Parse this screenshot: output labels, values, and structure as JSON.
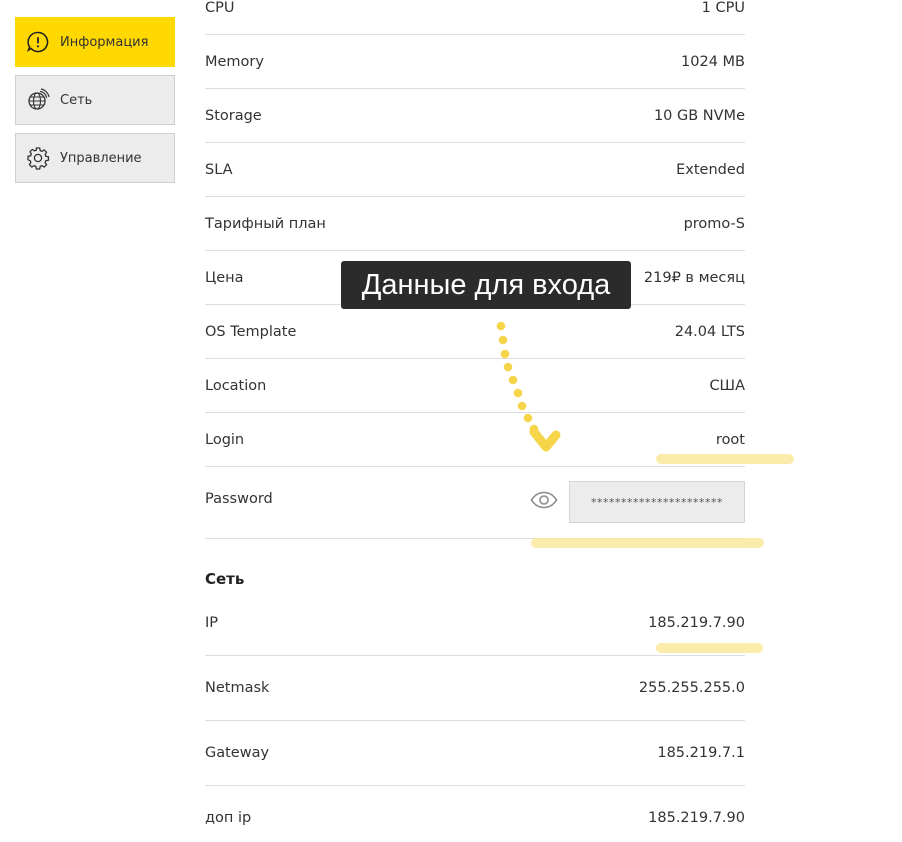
{
  "sidebar": {
    "items": [
      {
        "label": "Информация",
        "icon": "info-icon",
        "active": true
      },
      {
        "label": "Сеть",
        "icon": "network-icon",
        "active": false
      },
      {
        "label": "Управление",
        "icon": "gear-icon",
        "active": false
      }
    ]
  },
  "server": {
    "rows": [
      {
        "label": "CPU",
        "value": "1 CPU"
      },
      {
        "label": "Memory",
        "value": "1024 MB"
      },
      {
        "label": "Storage",
        "value": "10 GB NVMe"
      },
      {
        "label": "SLA",
        "value": "Extended"
      },
      {
        "label": "Тарифный план",
        "value": "promo-S"
      },
      {
        "label": "Цена",
        "value": "219₽ в месяц"
      },
      {
        "label": "OS Template",
        "value": "24.04 LTS"
      },
      {
        "label": "Location",
        "value": "США"
      },
      {
        "label": "Login",
        "value": "root"
      }
    ],
    "password": {
      "label": "Password",
      "masked_value": "**********************"
    }
  },
  "network": {
    "title": "Сеть",
    "rows": [
      {
        "label": "IP",
        "value": "185.219.7.90"
      },
      {
        "label": "Netmask",
        "value": "255.255.255.0"
      },
      {
        "label": "Gateway",
        "value": "185.219.7.1"
      },
      {
        "label": "доп ip",
        "value": "185.219.7.90"
      }
    ]
  },
  "annotation": {
    "tooltip": "Данные для входа",
    "highlight_color": "#fbe99c",
    "arrow_color": "#f7d54a"
  },
  "colors": {
    "accent": "#ffd800",
    "sidebar_bg": "#ececec",
    "tooltip_bg": "#2b2b2b"
  }
}
